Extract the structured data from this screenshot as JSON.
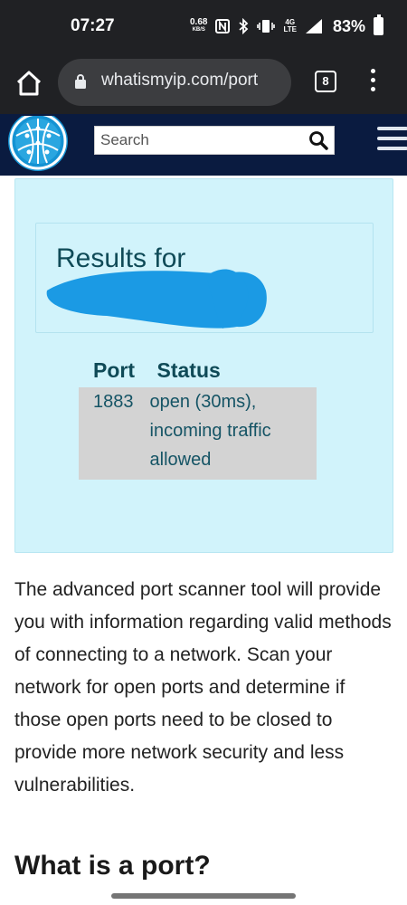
{
  "status_bar": {
    "time": "07:27",
    "net_speed": "0.68",
    "net_unit": "KB/S",
    "nfc": "N",
    "network_top": "4G",
    "network_bottom": "LTE",
    "battery": "83%",
    "icons": [
      "nfc-icon",
      "bluetooth-icon",
      "vibrate-icon",
      "signal-icon",
      "battery-icon"
    ]
  },
  "browser": {
    "url": "whatismyip.com/port",
    "tab_count": "8"
  },
  "site": {
    "search_placeholder": "Search",
    "brand_color": "#0a1b40"
  },
  "results": {
    "title": "Results for",
    "columns": [
      "Port",
      "Status"
    ],
    "rows": [
      {
        "port": "1883",
        "status": "open (30ms), incoming traffic allowed"
      }
    ],
    "panel_color": "#d1f3fb",
    "redaction_color": "#1b9ae4"
  },
  "content": {
    "paragraph": "The advanced port scanner tool will provide you with information regarding valid methods of connecting to a network. Scan your network for open ports and determine if those open ports need to be closed to provide more network security and less vulnerabilities.",
    "heading": "What is a port?"
  }
}
